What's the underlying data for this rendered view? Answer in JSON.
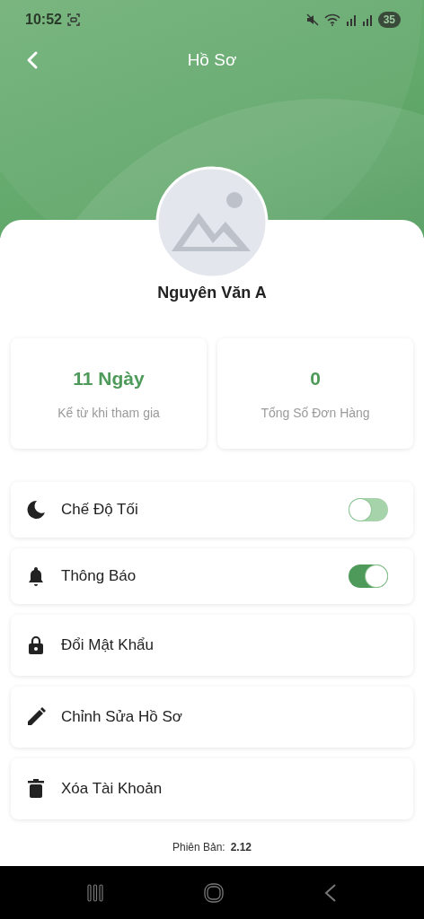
{
  "status_bar": {
    "time": "10:52",
    "battery": "35"
  },
  "app_bar": {
    "title": "Hồ Sơ"
  },
  "profile": {
    "name": "Nguyên Văn A"
  },
  "stats": [
    {
      "value": "11 Ngày",
      "label": "Kể từ khi tham gia"
    },
    {
      "value": "0",
      "label": "Tổng Số Đơn Hàng"
    }
  ],
  "settings": [
    {
      "kind": "toggle",
      "label": "Chế Độ Tối",
      "on": false
    },
    {
      "kind": "toggle",
      "label": "Thông Báo",
      "on": true
    },
    {
      "kind": "link",
      "label": "Đổi Mật Khẩu"
    },
    {
      "kind": "link",
      "label": "Chỉnh Sửa Hồ Sơ"
    },
    {
      "kind": "link",
      "label": "Xóa Tài Khoản"
    }
  ],
  "version": {
    "label": "Phiên Bản:",
    "value": "2.12"
  }
}
